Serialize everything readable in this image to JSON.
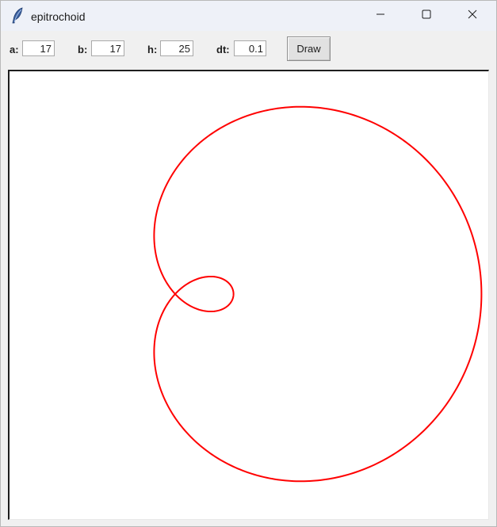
{
  "window": {
    "title": "epitrochoid",
    "icon": "feather-icon",
    "controls": [
      "minimize-icon",
      "maximize-icon",
      "close-icon"
    ]
  },
  "params": {
    "a_label": "a:",
    "a_value": "17",
    "b_label": "b:",
    "b_value": "17",
    "h_label": "h:",
    "h_value": "25",
    "dt_label": "dt:",
    "dt_value": "0.1"
  },
  "toolbar": {
    "draw_label": "Draw"
  },
  "plot": {
    "curve": "epitrochoid",
    "color": "#ff0000"
  }
}
